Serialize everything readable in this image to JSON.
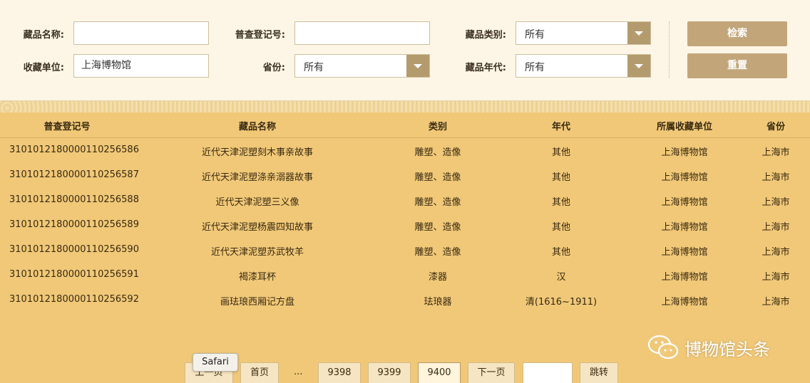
{
  "search": {
    "name_label": "藏品名称:",
    "name_value": "",
    "regno_label": "普查登记号:",
    "regno_value": "",
    "category_label": "藏品类别:",
    "category_value": "所有",
    "unit_label": "收藏单位:",
    "unit_value": "上海博物馆",
    "province_label": "省份:",
    "province_value": "所有",
    "era_label": "藏品年代:",
    "era_value": "所有",
    "search_button": "检索",
    "reset_button": "重置"
  },
  "table": {
    "headers": [
      "普查登记号",
      "藏品名称",
      "类别",
      "年代",
      "所属收藏单位",
      "省份"
    ],
    "rows": [
      [
        "31010121800001102565​86",
        "近代天津泥塑刻木事亲故事",
        "雕塑、造像",
        "其他",
        "上海博物馆",
        "上海市"
      ],
      [
        "3101012180000110256587",
        "近代天津泥塑涤亲溺器故事",
        "雕塑、造像",
        "其他",
        "上海博物馆",
        "上海市"
      ],
      [
        "3101012180000110256588",
        "近代天津泥塑三义像",
        "雕塑、造像",
        "其他",
        "上海博物馆",
        "上海市"
      ],
      [
        "3101012180000110256589",
        "近代天津泥塑杨震四知故事",
        "雕塑、造像",
        "其他",
        "上海博物馆",
        "上海市"
      ],
      [
        "3101012180000110256590",
        "近代天津泥塑苏武牧羊",
        "雕塑、造像",
        "其他",
        "上海博物馆",
        "上海市"
      ],
      [
        "3101012180000110256591",
        "褐漆耳杯",
        "漆器",
        "汉",
        "上海博物馆",
        "上海市"
      ],
      [
        "3101012180000110256592",
        "画珐琅西厢记方盘",
        "珐琅器",
        "清(1616~1911)",
        "上海博物馆",
        "上海市"
      ]
    ]
  },
  "pager": {
    "prev": "上一页",
    "first": "首页",
    "ellipsis": "...",
    "pages": [
      "9398",
      "9399",
      "9400"
    ],
    "current": "9400",
    "next": "下一页",
    "jump_value": "",
    "jump": "跳转"
  },
  "tooltip": "Safari",
  "watermark": "博物馆头条",
  "colors": {
    "panel_bg": "#fdf6e6",
    "table_bg": "#f0c878",
    "button": "#c2a67a"
  }
}
